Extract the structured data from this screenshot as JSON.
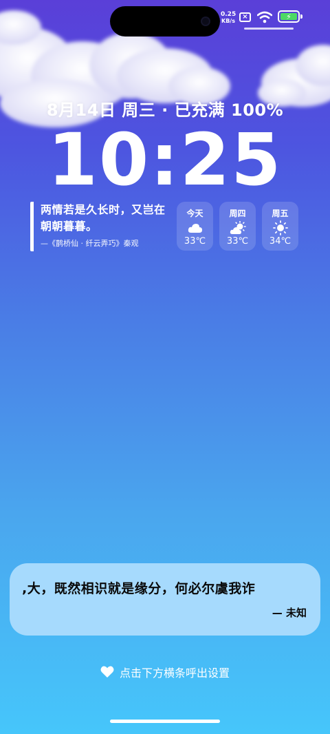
{
  "status_bar": {
    "net_speed_value": "0.25",
    "net_speed_unit": "KB/s",
    "sim_icon": "no-sim-icon",
    "wifi_icon": "wifi-icon",
    "battery_icon": "battery-charging-icon",
    "battery_color": "#4cd964"
  },
  "lockscreen": {
    "date_line": "8月14日 周三 · 已充满 100%",
    "time": "10:25"
  },
  "poem": {
    "text": "两情若是久长时，又岂在朝朝暮暮。",
    "source": "—《鹊桥仙 · 纤云弄巧》秦观"
  },
  "forecast": [
    {
      "day": "今天",
      "icon": "cloud-icon",
      "temp": "33℃"
    },
    {
      "day": "周四",
      "icon": "partly-sunny-icon",
      "temp": "33℃"
    },
    {
      "day": "周五",
      "icon": "sun-icon",
      "temp": "34℃"
    }
  ],
  "quote": {
    "text": ",大，既然相识就是缘分，何必尔虞我诈",
    "author": "— 未知"
  },
  "hint": {
    "icon": "heart-icon",
    "label": "点击下方横条呼出设置"
  },
  "colors": {
    "bg_top": "#5a3fd8",
    "bg_bottom": "#46c6fb",
    "quote_card": "#a6dafd"
  }
}
